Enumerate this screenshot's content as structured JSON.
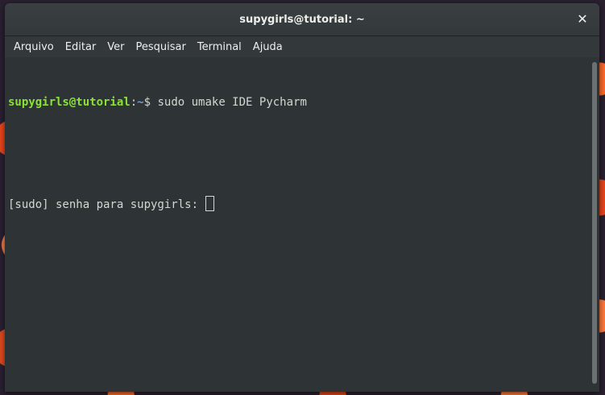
{
  "window": {
    "title": "supygirls@tutorial: ~"
  },
  "menu": {
    "items": [
      {
        "label": "Arquivo"
      },
      {
        "label": "Editar"
      },
      {
        "label": "Ver"
      },
      {
        "label": "Pesquisar"
      },
      {
        "label": "Terminal"
      },
      {
        "label": "Ajuda"
      }
    ]
  },
  "terminal": {
    "prompt_user": "supygirls@tutorial",
    "prompt_sep": ":",
    "prompt_path": "~",
    "prompt_symbol": "$",
    "command": " sudo umake IDE Pycharm",
    "sudo_prompt": "[sudo] senha para supygirls: "
  },
  "colors": {
    "user": "#8ae234",
    "path": "#729fcf",
    "background": "#2e3436"
  },
  "icons": {
    "close": "close-icon"
  }
}
